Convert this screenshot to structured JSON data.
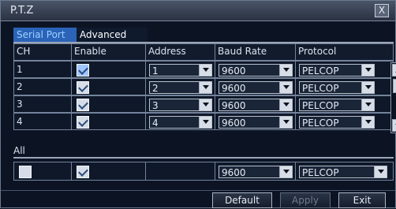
{
  "window": {
    "title": "P.T.Z",
    "close_glyph": "X"
  },
  "tabs": [
    {
      "label": "Serial Port",
      "active": true
    },
    {
      "label": "Advanced",
      "active": false
    }
  ],
  "table": {
    "headers": [
      "CH",
      "Enable",
      "Address",
      "Baud Rate",
      "Protocol"
    ],
    "rows": [
      {
        "ch": "1",
        "enable_checked": true,
        "address": "1",
        "baud": "9600",
        "protocol": "PELCOP"
      },
      {
        "ch": "2",
        "enable_checked": true,
        "address": "2",
        "baud": "9600",
        "protocol": "PELCOP"
      },
      {
        "ch": "3",
        "enable_checked": true,
        "address": "3",
        "baud": "9600",
        "protocol": "PELCOP"
      },
      {
        "ch": "4",
        "enable_checked": true,
        "address": "4",
        "baud": "9600",
        "protocol": "PELCOP"
      }
    ]
  },
  "all": {
    "label": "All",
    "checkbox_checked": false,
    "enable_checked": true,
    "baud": "9600",
    "protocol": "PELCOP"
  },
  "buttons": {
    "default": "Default",
    "apply": "Apply",
    "exit": "Exit"
  },
  "colors": {
    "accent": "#2a63b8"
  }
}
